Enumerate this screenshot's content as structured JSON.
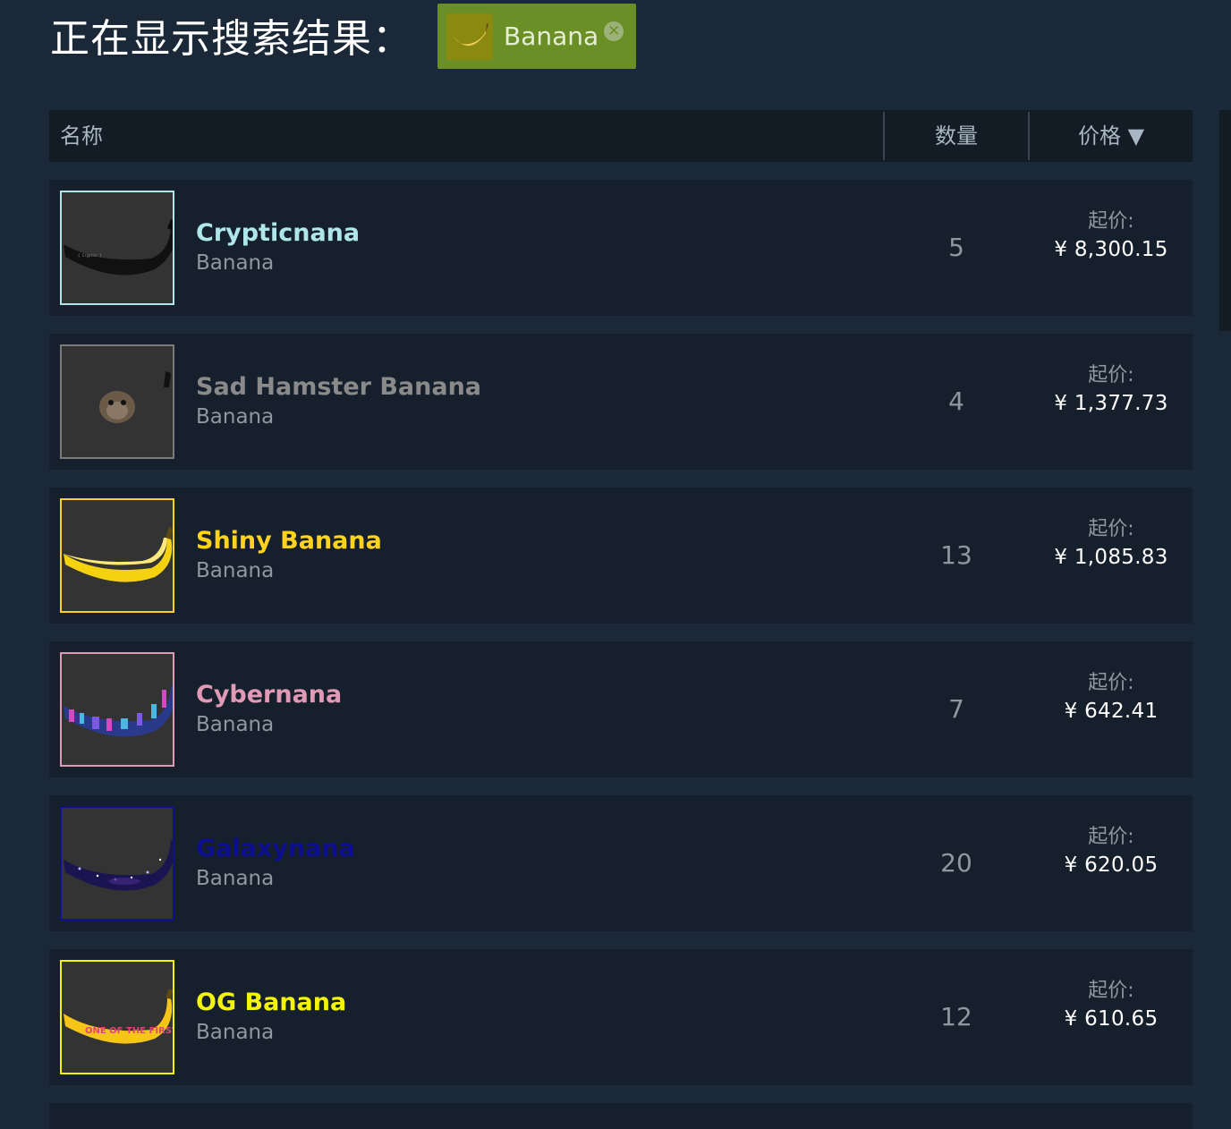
{
  "header": {
    "title": "正在显示搜索结果："
  },
  "filter": {
    "label": "Banana",
    "close_glyph": "✕",
    "icon": "banana-thumbnail-icon"
  },
  "table": {
    "columns": {
      "name": "名称",
      "quantity": "数量",
      "price": "价格 ▼"
    },
    "rows": [
      {
        "name": "Crypticnana",
        "game": "Banana",
        "quantity": "5",
        "price_label": "起价:",
        "price": "¥ 8,300.15",
        "name_color": "#aee6ea",
        "border_color": "#aee6ea",
        "image": "black-banana-icon"
      },
      {
        "name": "Sad Hamster Banana",
        "game": "Banana",
        "quantity": "4",
        "price_label": "起价:",
        "price": "¥ 1,377.73",
        "name_color": "#8a8a8a",
        "border_color": "#7a7a7a",
        "image": "hamster-icon"
      },
      {
        "name": "Shiny Banana",
        "game": "Banana",
        "quantity": "13",
        "price_label": "起价:",
        "price": "¥ 1,085.83",
        "name_color": "#ffd21f",
        "border_color": "#ffd21f",
        "image": "yellow-banana-icon"
      },
      {
        "name": "Cybernana",
        "game": "Banana",
        "quantity": "7",
        "price_label": "起价:",
        "price": "¥ 642.41",
        "name_color": "#e09ab5",
        "border_color": "#e09ab5",
        "image": "cyber-banana-icon"
      },
      {
        "name": "Galaxynana",
        "game": "Banana",
        "quantity": "20",
        "price_label": "起价:",
        "price": "¥ 620.05",
        "name_color": "#0d0d8f",
        "border_color": "#10108f",
        "image": "galaxy-banana-icon"
      },
      {
        "name": "OG Banana",
        "game": "Banana",
        "quantity": "12",
        "price_label": "起价:",
        "price": "¥ 610.65",
        "name_color": "#f4f40a",
        "border_color": "#f4f40a",
        "image": "og-banana-icon",
        "image_text": "ONE OF THE FIRST"
      }
    ]
  }
}
